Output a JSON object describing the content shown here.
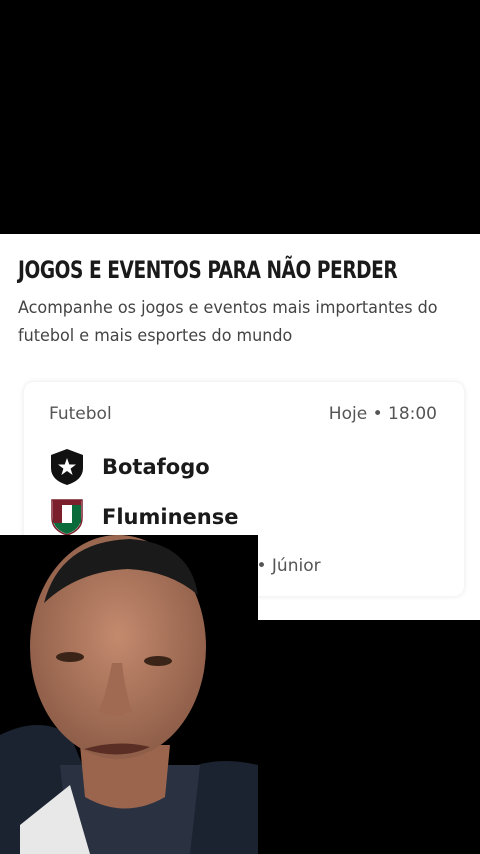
{
  "section": {
    "title": "JOGOS E EVENTOS PARA NÃO PERDER",
    "subtitle": "Acompanhe os jogos e eventos mais importantes do futebol e mais esportes do mundo"
  },
  "match_card": {
    "sport": "Futebol",
    "time": "Hoje • 18:00",
    "home_team": {
      "name": "Botafogo",
      "icon": "botafogo-crest-icon"
    },
    "away_team": {
      "name": "Fluminense",
      "icon": "fluminense-crest-icon"
    },
    "competition": "Friendly Carioca Campo • Júnior"
  },
  "overlay": {
    "type": "webcam-person"
  }
}
